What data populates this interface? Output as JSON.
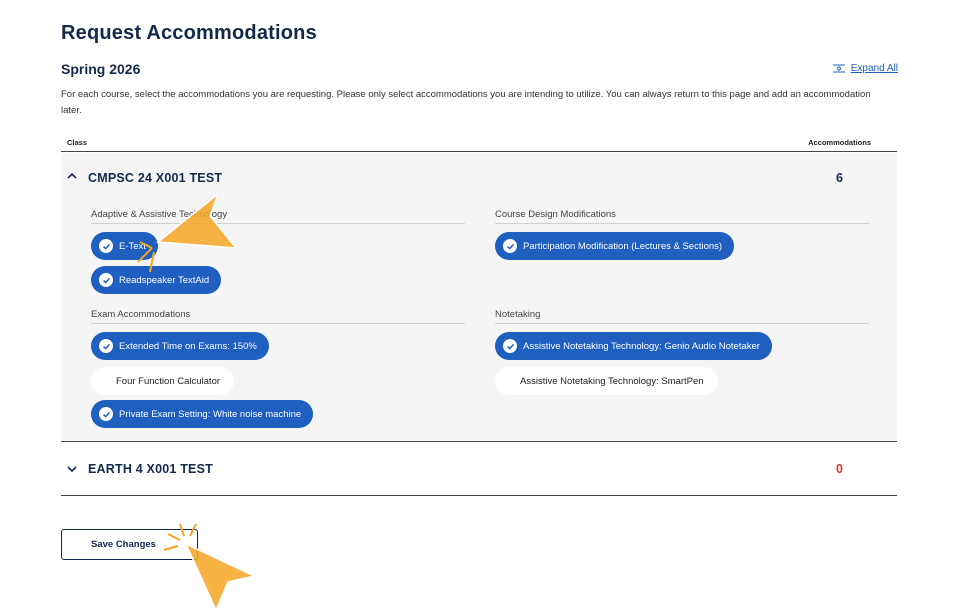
{
  "page": {
    "title": "Request Accommodations",
    "term": "Spring 2026",
    "expand_all_label": "Expand All",
    "intro": "For each course, select the accommodations you are requesting. Please only select accommodations you are intending to utilize. You can always return to this page and add an accommodation later."
  },
  "table": {
    "col_class": "Class",
    "col_accommodations": "Accommodations"
  },
  "courses": [
    {
      "name": "CMPSC 24 X001 TEST",
      "count": "6",
      "expanded": true,
      "categories": [
        {
          "label": "Adaptive & Assistive Technology",
          "items": [
            {
              "label": "E-Text",
              "selected": true
            },
            {
              "label": "Readspeaker TextAid",
              "selected": true
            }
          ]
        },
        {
          "label": "Course Design Modifications",
          "items": [
            {
              "label": "Participation Modification (Lectures & Sections)",
              "selected": true
            }
          ]
        },
        {
          "label": "Exam Accommodations",
          "items": [
            {
              "label": "Extended Time on Exams: 150%",
              "selected": true
            },
            {
              "label": "Four Function Calculator",
              "selected": false
            },
            {
              "label": "Private Exam Setting: White noise machine",
              "selected": true
            }
          ]
        },
        {
          "label": "Notetaking",
          "items": [
            {
              "label": "Assistive Notetaking Technology: Genio Audio Notetaker",
              "selected": true
            },
            {
              "label": "Assistive Notetaking Technology: SmartPen",
              "selected": false
            }
          ]
        }
      ]
    },
    {
      "name": "EARTH 4 X001 TEST",
      "count": "0",
      "expanded": false
    }
  ],
  "save_label": "Save Changes",
  "colors": {
    "navy": "#13294b",
    "chip_blue": "#1f5fbf",
    "zero_red": "#d23a2a",
    "panel_gray": "#f5f5f5",
    "pointer_orange": "#f5a623"
  },
  "icons": [
    "expand-all-icon",
    "chevron-up-icon",
    "chevron-down-icon",
    "check-circle-icon",
    "pointer-arrow-icon"
  ]
}
